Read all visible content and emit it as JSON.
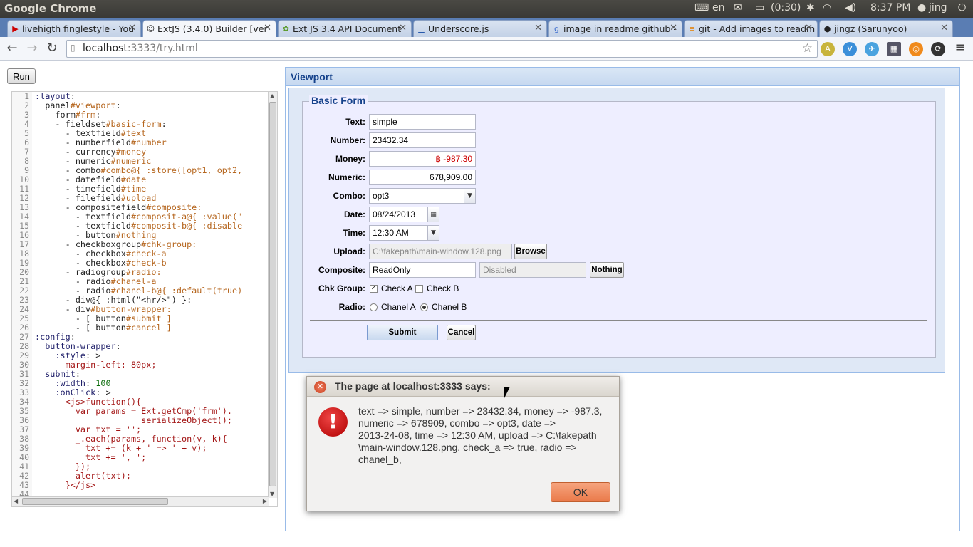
{
  "system": {
    "app_name": "Google Chrome",
    "keyboard": "en",
    "battery": "(0:30)",
    "time": "8:37 PM",
    "user": "jing"
  },
  "tabs": [
    {
      "label": "livehigth finglestyle - You",
      "favicon": "▶",
      "color": "#cc0000"
    },
    {
      "label": "ExtJS (3.4.0) Builder [ver",
      "favicon": "☺",
      "color": "#333333"
    },
    {
      "label": "Ext JS 3.4 API Document",
      "favicon": "✿",
      "color": "#5a9a2a"
    },
    {
      "label": "Underscore.js",
      "favicon": "▁",
      "color": "#2255aa"
    },
    {
      "label": "image in readme github -",
      "favicon": "g",
      "color": "#3366cc"
    },
    {
      "label": "git - Add images to readm",
      "favicon": "≡",
      "color": "#e08a1e"
    },
    {
      "label": "jingz (Sarunyoo)",
      "favicon": "●",
      "color": "#222222"
    }
  ],
  "address": {
    "host": "localhost",
    "rest": ":3333/try.html"
  },
  "run_label": "Run",
  "editor": {
    "line_numbers": [
      "1",
      "2",
      "3",
      "4",
      "5",
      "6",
      "7",
      "8",
      "9",
      "10",
      "11",
      "12",
      "13",
      "14",
      "15",
      "16",
      "17",
      "18",
      "19",
      "20",
      "21",
      "22",
      "23",
      "24",
      "25",
      "26",
      "27",
      "28",
      "29",
      "30",
      "31",
      "32",
      "33",
      "34",
      "35",
      "36",
      "37",
      "38",
      "39",
      "40",
      "41",
      "42",
      "43",
      "44"
    ],
    "lines": [
      [
        [
          "k",
          ":layout"
        ],
        [
          "d",
          ":"
        ]
      ],
      [
        [
          "d",
          "  panel"
        ],
        [
          "o",
          "#viewport"
        ],
        [
          "d",
          ":"
        ]
      ],
      [
        [
          "d",
          "    form"
        ],
        [
          "o",
          "#frm"
        ],
        [
          "d",
          ":"
        ]
      ],
      [
        [
          "d",
          "    - fieldset"
        ],
        [
          "o",
          "#basic-form"
        ],
        [
          "d",
          ":"
        ]
      ],
      [
        [
          "d",
          "      - textfield"
        ],
        [
          "o",
          "#text"
        ]
      ],
      [
        [
          "d",
          "      - numberfield"
        ],
        [
          "o",
          "#number"
        ]
      ],
      [
        [
          "d",
          "      - currency"
        ],
        [
          "o",
          "#money"
        ]
      ],
      [
        [
          "d",
          "      - numeric"
        ],
        [
          "o",
          "#numeric"
        ]
      ],
      [
        [
          "d",
          "      - combo"
        ],
        [
          "o",
          "#combo@{ :store([opt1, opt2,"
        ]
      ],
      [
        [
          "d",
          "      - datefield"
        ],
        [
          "o",
          "#date"
        ]
      ],
      [
        [
          "d",
          "      - timefield"
        ],
        [
          "o",
          "#time"
        ]
      ],
      [
        [
          "d",
          "      - filefield"
        ],
        [
          "o",
          "#upload"
        ]
      ],
      [
        [
          "d",
          "      - compositefield"
        ],
        [
          "o",
          "#composite:"
        ]
      ],
      [
        [
          "d",
          "        - textfield"
        ],
        [
          "o",
          "#composit-a@{ :value(\""
        ]
      ],
      [
        [
          "d",
          "        - textfield"
        ],
        [
          "o",
          "#composit-b@{ :disable"
        ]
      ],
      [
        [
          "d",
          "        - button"
        ],
        [
          "o",
          "#nothing"
        ]
      ],
      [
        [
          "d",
          "      - checkboxgroup"
        ],
        [
          "o",
          "#chk-group:"
        ]
      ],
      [
        [
          "d",
          "        - checkbox"
        ],
        [
          "o",
          "#check-a"
        ]
      ],
      [
        [
          "d",
          "        - checkbox"
        ],
        [
          "o",
          "#check-b"
        ]
      ],
      [
        [
          "d",
          "      - radiogroup"
        ],
        [
          "o",
          "#radio:"
        ]
      ],
      [
        [
          "d",
          "        - radio"
        ],
        [
          "o",
          "#chanel-a"
        ]
      ],
      [
        [
          "d",
          "        - radio"
        ],
        [
          "o",
          "#chanel-b@{ :default(true)"
        ]
      ],
      [
        [
          "d",
          "      - div@{ :html(\"<hr/>\") }:"
        ]
      ],
      [
        [
          "d",
          "      - div"
        ],
        [
          "o",
          "#button-wrapper:"
        ]
      ],
      [
        [
          "d",
          "        - [ button"
        ],
        [
          "o",
          "#submit ]"
        ]
      ],
      [
        [
          "d",
          "        - [ button"
        ],
        [
          "o",
          "#cancel ]"
        ]
      ],
      [
        [
          "k",
          ":config"
        ],
        [
          "d",
          ":"
        ]
      ],
      [
        [
          "k",
          "  button-wrapper"
        ],
        [
          "d",
          ":"
        ]
      ],
      [
        [
          "k",
          "    :style"
        ],
        [
          "d",
          ": >"
        ]
      ],
      [
        [
          "s",
          "      margin-left: 80px;"
        ]
      ],
      [
        [
          "k",
          "  submit"
        ],
        [
          "d",
          ":"
        ]
      ],
      [
        [
          "k",
          "    :width"
        ],
        [
          "d",
          ": "
        ],
        [
          "n",
          "100"
        ]
      ],
      [
        [
          "k",
          "    :onClick"
        ],
        [
          "d",
          ": >"
        ]
      ],
      [
        [
          "s",
          "      <js>function(){"
        ]
      ],
      [
        [
          "s",
          "        var params = Ext.getCmp('frm')."
        ]
      ],
      [
        [
          "s",
          "                     serializeObject();"
        ]
      ],
      [
        [
          "s",
          "        var txt = '';"
        ]
      ],
      [
        [
          "s",
          "        _.each(params, function(v, k){"
        ]
      ],
      [
        [
          "s",
          "          txt += (k + ' => ' + v);"
        ]
      ],
      [
        [
          "s",
          "          txt += ', ';"
        ]
      ],
      [
        [
          "s",
          "        });"
        ]
      ],
      [
        [
          "s",
          "        alert(txt);"
        ]
      ],
      [
        [
          "s",
          "      }</js>"
        ]
      ],
      [
        [
          "d",
          ""
        ]
      ]
    ]
  },
  "viewport": {
    "title": "Viewport",
    "legend": "Basic Form",
    "fields": {
      "text": {
        "label": "Text:",
        "value": "simple"
      },
      "number": {
        "label": "Number:",
        "value": "23432.34"
      },
      "money": {
        "label": "Money:",
        "value": "฿ -987.30"
      },
      "numeric": {
        "label": "Numeric:",
        "value": "678,909.00"
      },
      "combo": {
        "label": "Combo:",
        "value": "opt3"
      },
      "date": {
        "label": "Date:",
        "value": "08/24/2013"
      },
      "time": {
        "label": "Time:",
        "value": "12:30 AM"
      },
      "upload": {
        "label": "Upload:",
        "value": "C:\\fakepath\\main-window.128.png",
        "button": "Browse"
      },
      "composite": {
        "label": "Composite:",
        "a": "ReadOnly",
        "b": "Disabled",
        "button": "Nothing"
      },
      "chk": {
        "label": "Chk Group:",
        "a": "Check A",
        "b": "Check B"
      },
      "radio": {
        "label": "Radio:",
        "a": "Chanel A",
        "b": "Chanel B"
      }
    },
    "submit": "Submit",
    "cancel": "Cancel"
  },
  "dialog": {
    "title": "The page at localhost:3333 says:",
    "message": "text => simple, number => 23432.34, money => -987.3,\nnumeric => 678909, combo => opt3, date =>\n2013-24-08, time => 12:30 AM, upload => C:\\fakepath\n\\main-window.128.png, check_a => true, radio =>\nchanel_b,",
    "ok": "OK"
  },
  "colors": {
    "accent": "#15428b",
    "ok_button": "#ea7a4a",
    "error_red": "#cc0000"
  }
}
